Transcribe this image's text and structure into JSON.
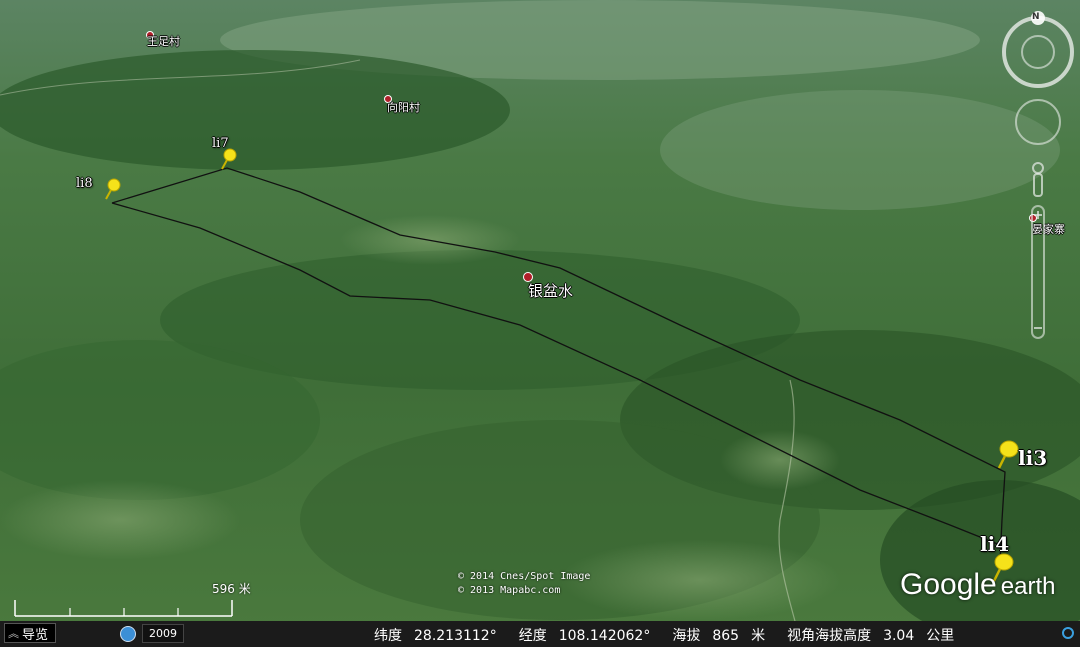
{
  "pins": [
    {
      "id": "li8",
      "label": "li8"
    },
    {
      "id": "li7",
      "label": "li7"
    },
    {
      "id": "li3",
      "label": "li3"
    },
    {
      "id": "li4",
      "label": "li4"
    }
  ],
  "places": [
    {
      "id": "top-left-village",
      "label": "王足村"
    },
    {
      "id": "top-middle-village",
      "label": "向阳村"
    },
    {
      "id": "yinpenshui",
      "label": "银盆水"
    },
    {
      "id": "right-village",
      "label": "晏家寨"
    }
  ],
  "compass": {
    "north_label": "N"
  },
  "copyright": {
    "line1": "© 2014 Cnes/Spot Image",
    "line2": "© 2013 Mapabc.com"
  },
  "logo": {
    "google": "Google",
    "earth": "earth"
  },
  "scale": {
    "value": "596",
    "unit": "米"
  },
  "statusbar": {
    "nav_label": "导览",
    "imagery_year": "2009",
    "lat_label": "纬度",
    "lat_value": "28.213112°",
    "lon_label": "经度",
    "lon_value": "108.142062°",
    "elev_label": "海拔",
    "elev_value": "865",
    "elev_unit": "米",
    "eye_label": "视角海拔高度",
    "eye_value": "3.04",
    "eye_unit": "公里"
  },
  "colors": {
    "route": "#111111",
    "pin_yellow": "#f5e21a",
    "statusbar": "#1b1b1b"
  }
}
